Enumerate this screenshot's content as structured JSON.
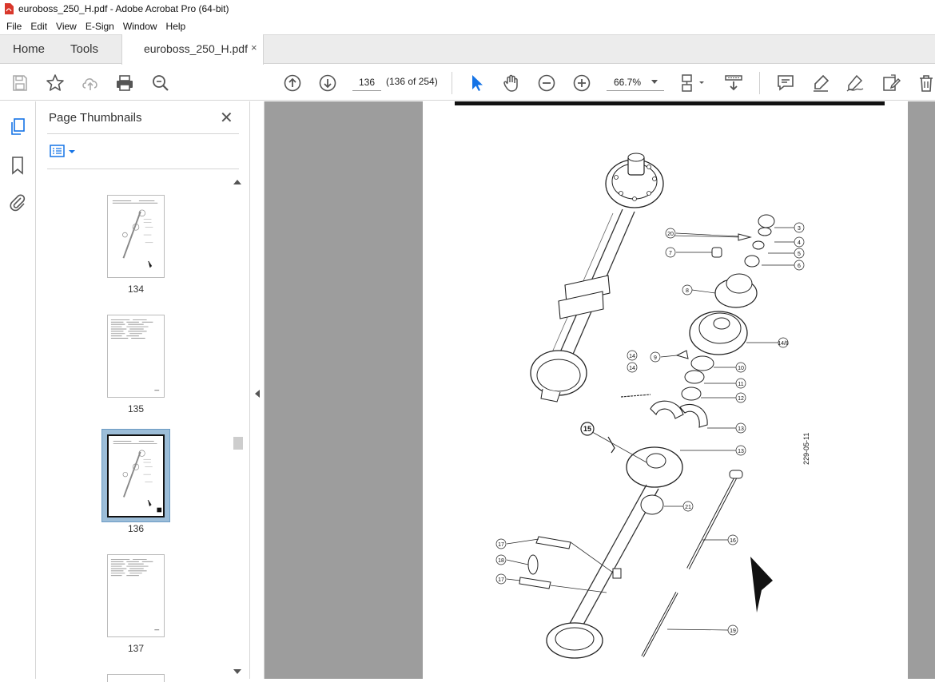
{
  "window": {
    "title": "euroboss_250_H.pdf - Adobe Acrobat Pro (64-bit)"
  },
  "menu": [
    "File",
    "Edit",
    "View",
    "E-Sign",
    "Window",
    "Help"
  ],
  "tabs": {
    "home": "Home",
    "tools": "Tools",
    "document": "euroboss_250_H.pdf",
    "close_glyph": "×"
  },
  "toolbar": {
    "page_number": "136",
    "page_count": "(136 of 254)",
    "zoom": "66.7%",
    "icons": [
      "save-icon",
      "star-icon",
      "cloud-upload-icon",
      "print-icon",
      "zoom-search-icon",
      "page-up-icon",
      "page-down-icon",
      "select-pointer-icon",
      "hand-icon",
      "zoom-out-icon",
      "zoom-in-icon",
      "page-fit-icon",
      "scroll-mode-icon",
      "comment-icon",
      "highlight-icon",
      "sign-icon",
      "edit-pdf-icon",
      "delete-icon"
    ]
  },
  "rail": {
    "icons": [
      "page-thumbnails-icon",
      "bookmark-icon",
      "attachment-icon"
    ]
  },
  "panel": {
    "title": "Page Thumbnails",
    "close_glyph": "✕",
    "thumbnails": [
      {
        "label": "134",
        "selected": false
      },
      {
        "label": "135",
        "selected": false
      },
      {
        "label": "136",
        "selected": true
      },
      {
        "label": "137",
        "selected": false
      }
    ]
  },
  "drawing": {
    "code": "229-05-11",
    "callouts": [
      "3",
      "4",
      "5",
      "6",
      "7",
      "8",
      "9",
      "10",
      "11",
      "12",
      "13",
      "14",
      "15",
      "16",
      "17",
      "18",
      "19",
      "20",
      "21",
      "14/8"
    ]
  },
  "colors": {
    "accent": "#1473e6",
    "pdf_red": "#d9372b",
    "doc_background": "#9d9d9d",
    "selection": "#9cbdd8"
  }
}
